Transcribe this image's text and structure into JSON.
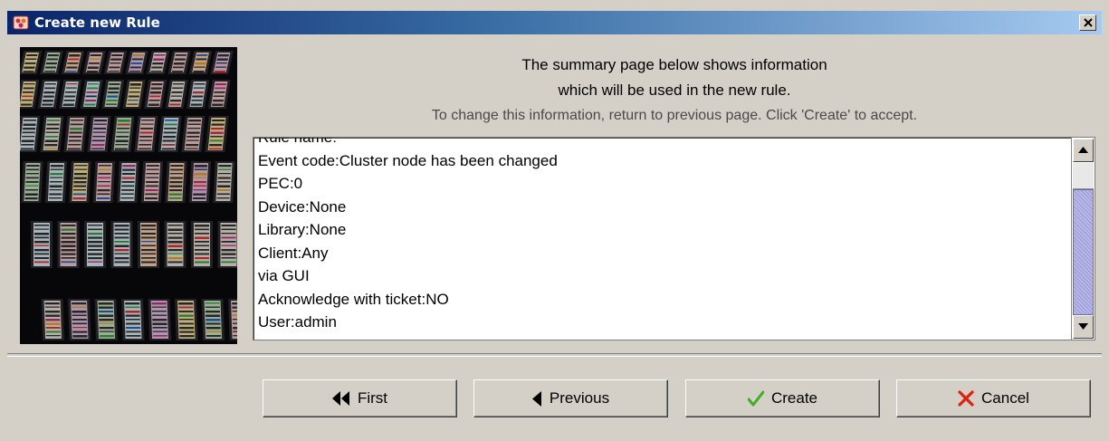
{
  "window": {
    "title": "Create new Rule",
    "title_icon": "app-icon",
    "close_icon": "close-icon"
  },
  "info": {
    "line1": "The summary page below shows information",
    "line2": "which will be used in the new rule.",
    "line3": "To change this information, return to previous page. Click 'Create' to accept."
  },
  "summary": {
    "lines": [
      "Rule name:",
      "Event code:Cluster node has been changed",
      "PEC:0",
      "Device:None",
      "Library:None",
      "Client:Any",
      "via GUI",
      "Acknowledge with ticket:NO",
      "User:admin"
    ]
  },
  "buttons": {
    "first": {
      "label": "First",
      "icon": "double-arrow-left-icon"
    },
    "previous": {
      "label": "Previous",
      "icon": "arrow-left-icon"
    },
    "create": {
      "label": "Create",
      "icon": "checkmark-icon",
      "icon_color": "#3cb020"
    },
    "cancel": {
      "label": "Cancel",
      "icon": "x-icon",
      "icon_color": "#e02010"
    }
  },
  "colors": {
    "titlebar_start": "#0a246a",
    "titlebar_end": "#a6caf0",
    "window_bg": "#d4d0c8",
    "scroll_thumb": "#b8b8e8"
  }
}
